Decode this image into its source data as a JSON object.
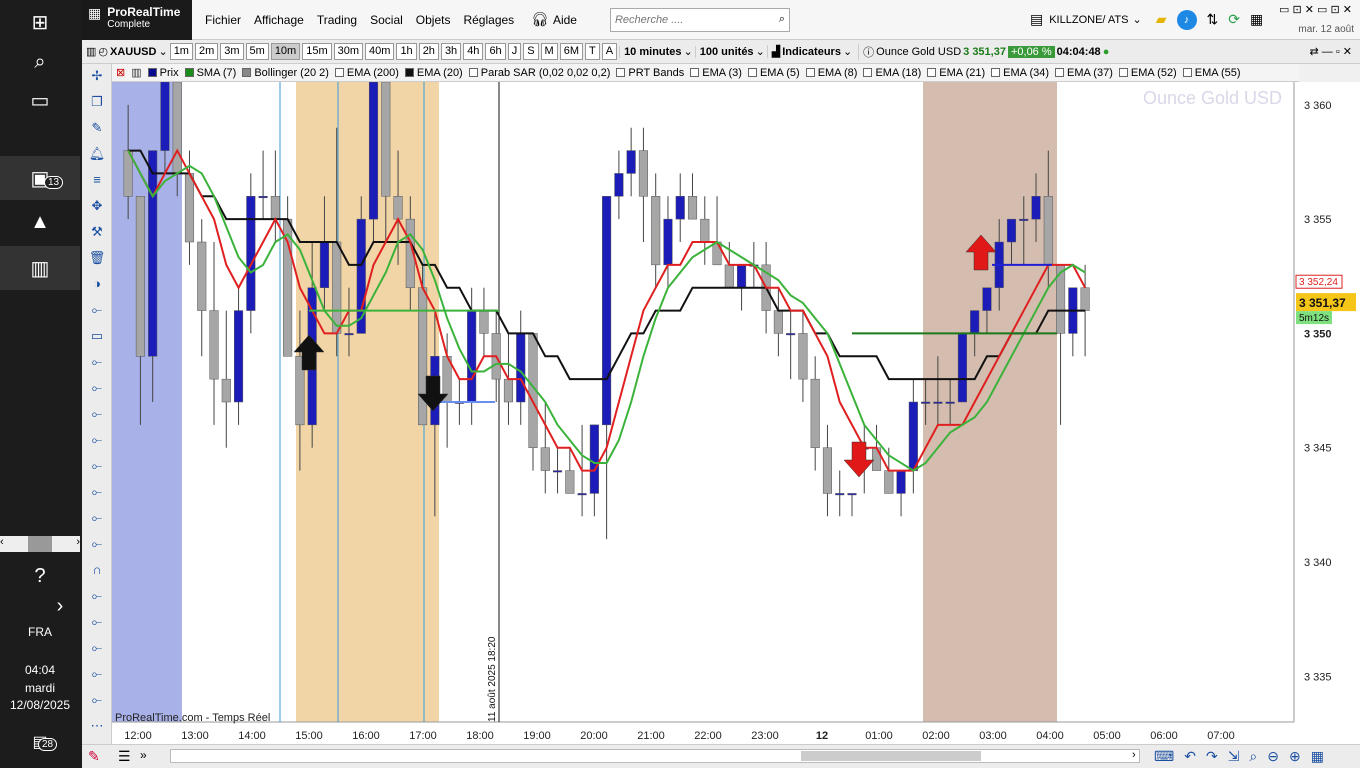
{
  "taskbar": {
    "badge_mail": "13",
    "lang": "FRA",
    "time": "04:04",
    "day": "mardi",
    "date": "12/08/2025",
    "notif_count": "28"
  },
  "app": {
    "brand": "ProRealTime",
    "brand_sub": "Complete",
    "menu": [
      "Fichier",
      "Affichage",
      "Trading",
      "Social",
      "Objets",
      "Réglages"
    ],
    "help": "Aide",
    "search_placeholder": "Recherche ....",
    "scan_label": "KILLZONE/ ATS",
    "clock_date": "mar. 12 août"
  },
  "toolbar": {
    "symbol": "XAUUSD",
    "timeframes": [
      "1m",
      "2m",
      "3m",
      "5m",
      "10m",
      "15m",
      "30m",
      "40m",
      "1h",
      "2h",
      "3h",
      "4h",
      "6h",
      "J",
      "S",
      "M",
      "6M",
      "T",
      "A"
    ],
    "selected_tf": "10m",
    "period": "10 minutes",
    "units": "100 unités",
    "indicators": "Indicateurs",
    "instrument": "Ounce Gold USD",
    "price": "3 351,37",
    "change": "+0,06 %",
    "clock": "04:04:48"
  },
  "indicators": [
    {
      "label": "Prix",
      "color": "#0a0a8c"
    },
    {
      "label": "SMA (7)",
      "color": "#1a8c1a"
    },
    {
      "label": "Bollinger (20 2)",
      "color": "#888888"
    },
    {
      "label": "EMA (200)",
      "color": "#ffffff"
    },
    {
      "label": "EMA (20)",
      "color": "#111111"
    },
    {
      "label": "Parab SAR (0,02 0,02 0,2)",
      "color": "#ffffff"
    },
    {
      "label": "PRT Bands",
      "color": "#ffffff"
    },
    {
      "label": "EMA (3)",
      "color": "#ffffff"
    },
    {
      "label": "EMA (5)",
      "color": "#ffffff"
    },
    {
      "label": "EMA (8)",
      "color": "#ffffff"
    },
    {
      "label": "EMA (18)",
      "color": "#ffffff"
    },
    {
      "label": "EMA (21)",
      "color": "#ffffff"
    },
    {
      "label": "EMA (34)",
      "color": "#ffffff"
    },
    {
      "label": "EMA (37)",
      "color": "#ffffff"
    },
    {
      "label": "EMA (52)",
      "color": "#ffffff"
    },
    {
      "label": "EMA (55)",
      "color": "#ffffff"
    }
  ],
  "chart": {
    "watermark": "Ounce Gold USD",
    "source": "ProRealTime.com - Temps Réel",
    "price_tag": "3 351,37",
    "red_tag": "3 352,24",
    "countdown": "5m12s",
    "vline_label": "11 août 2025 18:20"
  },
  "chart_data": {
    "type": "candlestick",
    "ylim": [
      3333,
      3361
    ],
    "y_ticks": [
      "3 360",
      "3 355",
      "3 350",
      "3 345",
      "3 340",
      "3 335"
    ],
    "x_labels": [
      "12:00",
      "13:00",
      "14:00",
      "15:00",
      "16:00",
      "17:00",
      "18:00",
      "19:00",
      "20:00",
      "21:00",
      "22:00",
      "23:00",
      "12",
      "01:00",
      "02:00",
      "03:00",
      "04:00",
      "05:00",
      "06:00",
      "07:00"
    ],
    "ohlc": [
      [
        3358,
        3360,
        3355,
        3356
      ],
      [
        3356,
        3356,
        3346,
        3349
      ],
      [
        3349,
        3358,
        3347,
        3358
      ],
      [
        3358,
        3362,
        3357,
        3361
      ],
      [
        3361,
        3362,
        3356,
        3357
      ],
      [
        3357,
        3358,
        3353,
        3354
      ],
      [
        3354,
        3355,
        3349,
        3351
      ],
      [
        3351,
        3354,
        3346,
        3348
      ],
      [
        3348,
        3351,
        3345,
        3347
      ],
      [
        3347,
        3352,
        3346,
        3351
      ],
      [
        3351,
        3357,
        3350,
        3356
      ],
      [
        3356,
        3358,
        3355,
        3356
      ],
      [
        3356,
        3358,
        3354,
        3355
      ],
      [
        3355,
        3356,
        3350,
        3349
      ],
      [
        3349,
        3351,
        3344,
        3346
      ],
      [
        3346,
        3354,
        3345,
        3352
      ],
      [
        3352,
        3356,
        3351,
        3354
      ],
      [
        3354,
        3359,
        3349,
        3350
      ],
      [
        3350,
        3352,
        3349,
        3350
      ],
      [
        3350,
        3356,
        3350,
        3355
      ],
      [
        3355,
        3363,
        3354,
        3361
      ],
      [
        3361,
        3362,
        3354,
        3356
      ],
      [
        3356,
        3358,
        3353,
        3355
      ],
      [
        3355,
        3356,
        3351,
        3352
      ],
      [
        3352,
        3353,
        3346,
        3346
      ],
      [
        3346,
        3351,
        3342,
        3349
      ],
      [
        3349,
        3350,
        3345,
        3347
      ],
      [
        3347,
        3348,
        3346,
        3347
      ],
      [
        3347,
        3352,
        3346,
        3351
      ],
      [
        3351,
        3352,
        3349,
        3350
      ],
      [
        3350,
        3351,
        3347,
        3348
      ],
      [
        3348,
        3350,
        3346,
        3347
      ],
      [
        3347,
        3351,
        3346,
        3350
      ],
      [
        3350,
        3350,
        3344,
        3345
      ],
      [
        3345,
        3347,
        3343,
        3344
      ],
      [
        3344,
        3345,
        3343,
        3344
      ],
      [
        3344,
        3345,
        3343,
        3343
      ],
      [
        3343,
        3346,
        3342,
        3343
      ],
      [
        3343,
        3346,
        3342,
        3346
      ],
      [
        3346,
        3356,
        3341,
        3356
      ],
      [
        3356,
        3358,
        3355,
        3357
      ],
      [
        3357,
        3359,
        3356,
        3358
      ],
      [
        3358,
        3359,
        3354,
        3356
      ],
      [
        3356,
        3357,
        3352,
        3353
      ],
      [
        3353,
        3356,
        3352,
        3355
      ],
      [
        3355,
        3357,
        3354,
        3356
      ],
      [
        3356,
        3357,
        3355,
        3355
      ],
      [
        3355,
        3356,
        3353,
        3354
      ],
      [
        3354,
        3356,
        3353,
        3353
      ],
      [
        3353,
        3354,
        3352,
        3352
      ],
      [
        3352,
        3353,
        3351,
        3353
      ],
      [
        3353,
        3354,
        3352,
        3353
      ],
      [
        3353,
        3354,
        3350,
        3351
      ],
      [
        3351,
        3352,
        3349,
        3350
      ],
      [
        3350,
        3351,
        3348,
        3350
      ],
      [
        3350,
        3351,
        3347,
        3348
      ],
      [
        3348,
        3349,
        3344,
        3345
      ],
      [
        3345,
        3346,
        3342,
        3343
      ],
      [
        3343,
        3344,
        3342,
        3343
      ],
      [
        3343,
        3343,
        3342,
        3343
      ],
      [
        3345,
        3346,
        3343,
        3345
      ],
      [
        3345,
        3346,
        3344,
        3344
      ],
      [
        3344,
        3345,
        3343,
        3343
      ],
      [
        3343,
        3344,
        3342,
        3344
      ],
      [
        3344,
        3348,
        3343,
        3347
      ],
      [
        3347,
        3348,
        3346,
        3347
      ],
      [
        3347,
        3349,
        3346,
        3347
      ],
      [
        3347,
        3348,
        3346,
        3347
      ],
      [
        3347,
        3350,
        3347,
        3350
      ],
      [
        3350,
        3351,
        3349,
        3351
      ],
      [
        3351,
        3352,
        3350,
        3352
      ],
      [
        3352,
        3355,
        3351,
        3354
      ],
      [
        3354,
        3355,
        3353,
        3355
      ],
      [
        3355,
        3356,
        3353,
        3355
      ],
      [
        3355,
        3357,
        3354,
        3356
      ],
      [
        3356,
        3358,
        3352,
        3353
      ],
      [
        3353,
        3353,
        3346,
        3350
      ],
      [
        3350,
        3352,
        3349,
        3352
      ],
      [
        3352,
        3353,
        3349,
        3351
      ]
    ],
    "sma7": [
      3358,
      3357,
      3356,
      3357,
      3358,
      3357,
      3356,
      3355,
      3353,
      3352,
      3353,
      3354,
      3355,
      3354,
      3352,
      3351,
      3350,
      3350,
      3351,
      3351,
      3353,
      3354,
      3355,
      3354,
      3352,
      3351,
      3349,
      3348,
      3348,
      3349,
      3349,
      3348,
      3348,
      3347,
      3346,
      3345,
      3345,
      3344,
      3344,
      3345,
      3347,
      3349,
      3351,
      3352,
      3353,
      3353,
      3354,
      3354,
      3354,
      3353,
      3353,
      3353,
      3352,
      3352,
      3351,
      3351,
      3350,
      3349,
      3347,
      3346,
      3345,
      3345,
      3344,
      3344,
      3344,
      3345,
      3346,
      3346,
      3346,
      3347,
      3348,
      3349,
      3350,
      3351,
      3352,
      3353,
      3353,
      3353,
      3352
    ],
    "ema20": [
      3358,
      3358,
      3357,
      3357,
      3357,
      3357,
      3356,
      3356,
      3355,
      3355,
      3355,
      3355,
      3355,
      3355,
      3354,
      3354,
      3354,
      3354,
      3353,
      3353,
      3354,
      3354,
      3354,
      3354,
      3353,
      3353,
      3352,
      3352,
      3351,
      3351,
      3351,
      3350,
      3350,
      3350,
      3349,
      3349,
      3348,
      3348,
      3348,
      3348,
      3349,
      3350,
      3350,
      3351,
      3351,
      3351,
      3352,
      3352,
      3352,
      3352,
      3352,
      3352,
      3352,
      3351,
      3351,
      3351,
      3350,
      3350,
      3349,
      3349,
      3349,
      3349,
      3348,
      3348,
      3348,
      3348,
      3348,
      3348,
      3348,
      3348,
      3349,
      3349,
      3350,
      3350,
      3350,
      3351,
      3351,
      3351,
      3351
    ]
  }
}
